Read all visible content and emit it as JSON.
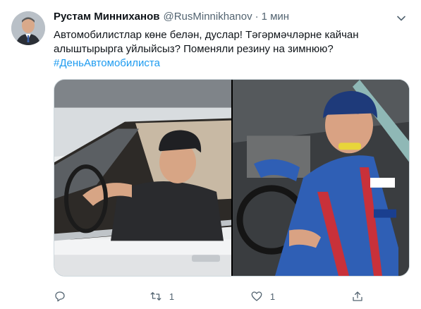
{
  "tweet": {
    "author_name": "Рустам Минниханов",
    "handle": "@RusMinnikhanov",
    "separator": "·",
    "time": "1 мин",
    "text_line1": "Автомобилистлар көне белән, дуслар! Тәгәрмәчләрне кайчан",
    "text_line2": "алыштырырга уйлыйсыз? Поменяли резину на зимнюю?",
    "hashtag": "#ДеньАвтомобилиста"
  },
  "actions": {
    "reply_count": "",
    "retweet_count": "1",
    "like_count": "1"
  },
  "icons": {
    "menu": "chevron-down-icon",
    "reply": "reply-icon",
    "retweet": "retweet-icon",
    "like": "heart-icon",
    "share": "share-icon"
  },
  "colors": {
    "hashtag": "#1d9bf0",
    "secondary_text": "#536471",
    "primary_text": "#0f1419"
  }
}
